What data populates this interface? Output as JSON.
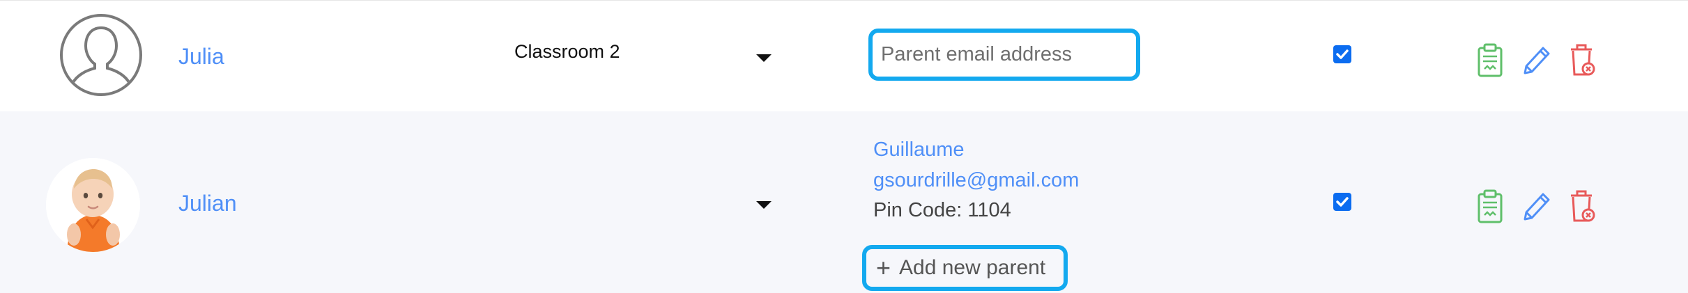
{
  "rows": [
    {
      "name": "Julia",
      "classroom": "Classroom 2",
      "email_placeholder": "Parent email address",
      "checked": true
    },
    {
      "name": "Julian",
      "classroom": "",
      "parent": {
        "name": "Guillaume",
        "email": "gsourdrille@gmail.com",
        "pin_label": "Pin Code: 1104"
      },
      "add_parent_label": "Add new parent",
      "checked": true
    }
  ],
  "icons": {
    "avatar_default": "user-silhouette-icon",
    "dropdown": "caret-down-icon",
    "report": "clipboard-icon",
    "edit": "pencil-icon",
    "delete": "trash-icon",
    "add": "plus-icon"
  },
  "colors": {
    "accent_blue": "#4f8ff7",
    "highlight_border": "#13a9ef",
    "checkbox": "#0b6cf0",
    "report_green": "#5fbf6a",
    "delete_red": "#e85a5a",
    "row_alt_bg": "#f6f7fb"
  }
}
